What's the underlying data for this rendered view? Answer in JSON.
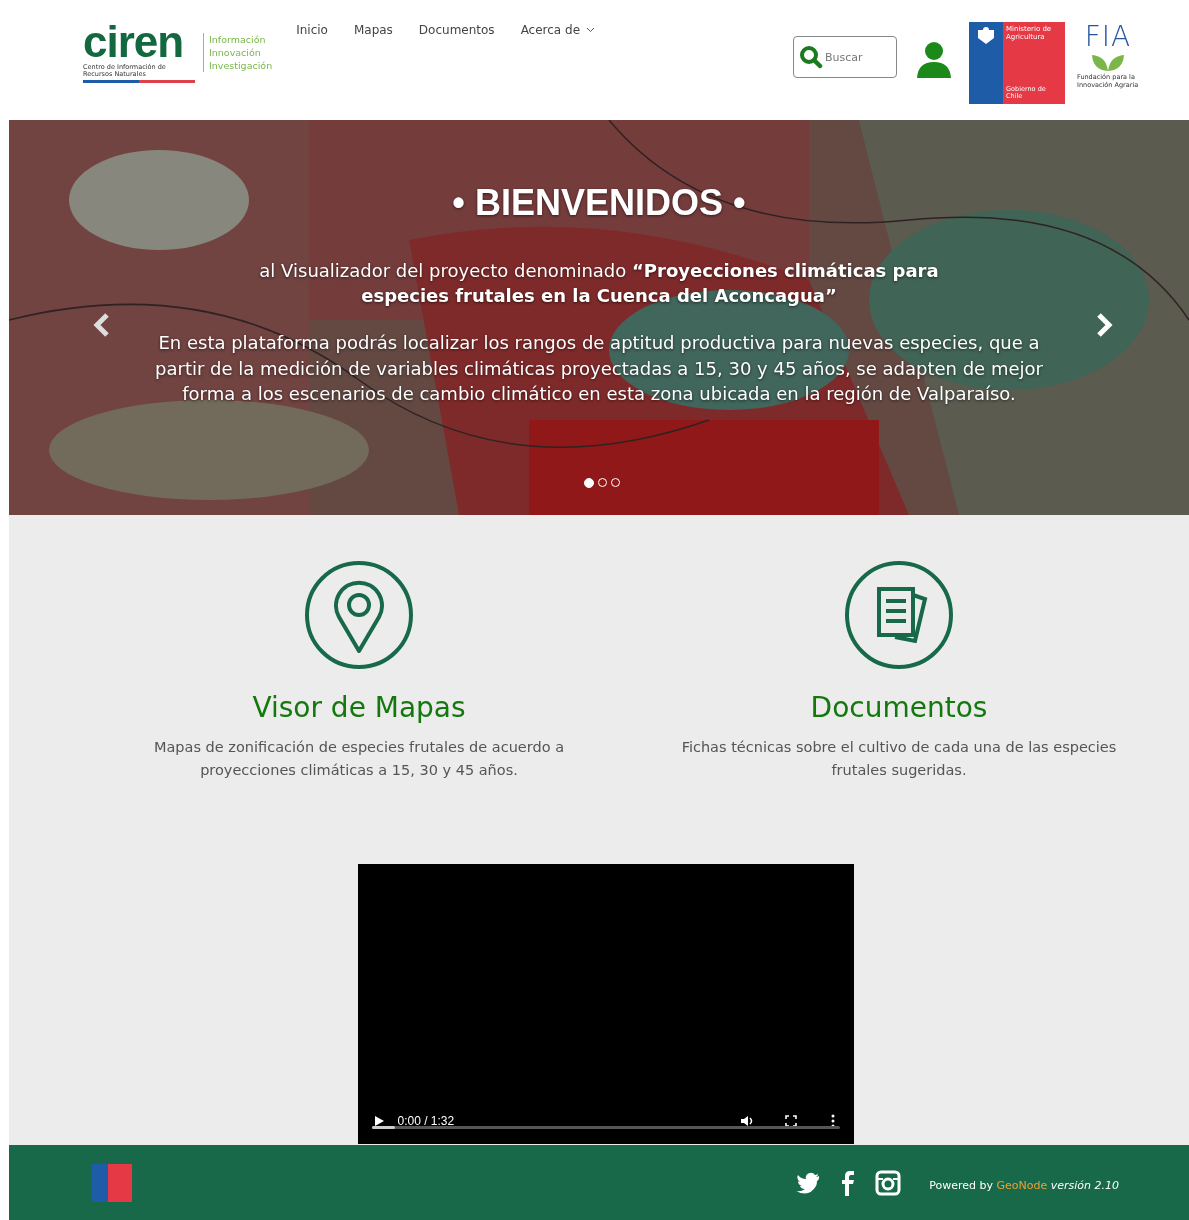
{
  "header": {
    "logo": {
      "name": "ciren",
      "subtitle": "Centro de Información de Recursos Naturales",
      "taglines": [
        "Información",
        "Innovación",
        "Investigación"
      ]
    },
    "nav": [
      {
        "label": "Inicio",
        "kind": "link"
      },
      {
        "label": "Mapas",
        "kind": "link"
      },
      {
        "label": "Documentos",
        "kind": "link"
      },
      {
        "label": "Acerca de",
        "kind": "dropdown"
      }
    ],
    "search": {
      "placeholder": "Buscar"
    },
    "ministry_logo": {
      "title": "Ministerio de Agricultura",
      "footer": "Gobierno de Chile"
    },
    "fia_logo": {
      "letters": "FIA",
      "caption": "Fundación para la Innovación Agraria"
    }
  },
  "hero": {
    "title": "• BIENVENIDOS •",
    "intro": "al Visualizador del proyecto denominado **“Proyecciones climáticas para especies frutales en la Cuenca del Aconcagua”**",
    "body": "En esta plataforma podrás localizar los rangos de aptitud productiva para nuevas especies, que a partir de la medición de variables climáticas proyectadas a 15, 30 y 45 años, se adapten de mejor forma a los escenarios de cambio climático en esta zona ubicada en la región de Valparaíso.",
    "dots": [
      {
        "selected": true
      },
      {
        "selected": false
      },
      {
        "selected": false
      }
    ]
  },
  "features": [
    {
      "kind": "map",
      "title": "Visor de Mapas",
      "text": "Mapas de zonificación de especies frutales de acuerdo a proyecciones climáticas a 15, 30 y 45 años."
    },
    {
      "kind": "documents",
      "title": "Documentos",
      "text": "Fichas técnicas sobre el cultivo de cada una de las especies frutales sugeridas."
    }
  ],
  "video": {
    "time": "0:00 / 1:32",
    "level": 0.05
  },
  "footer": {
    "powered": "Powered by",
    "link": "GeoNode",
    "version": "versión 2.10"
  }
}
